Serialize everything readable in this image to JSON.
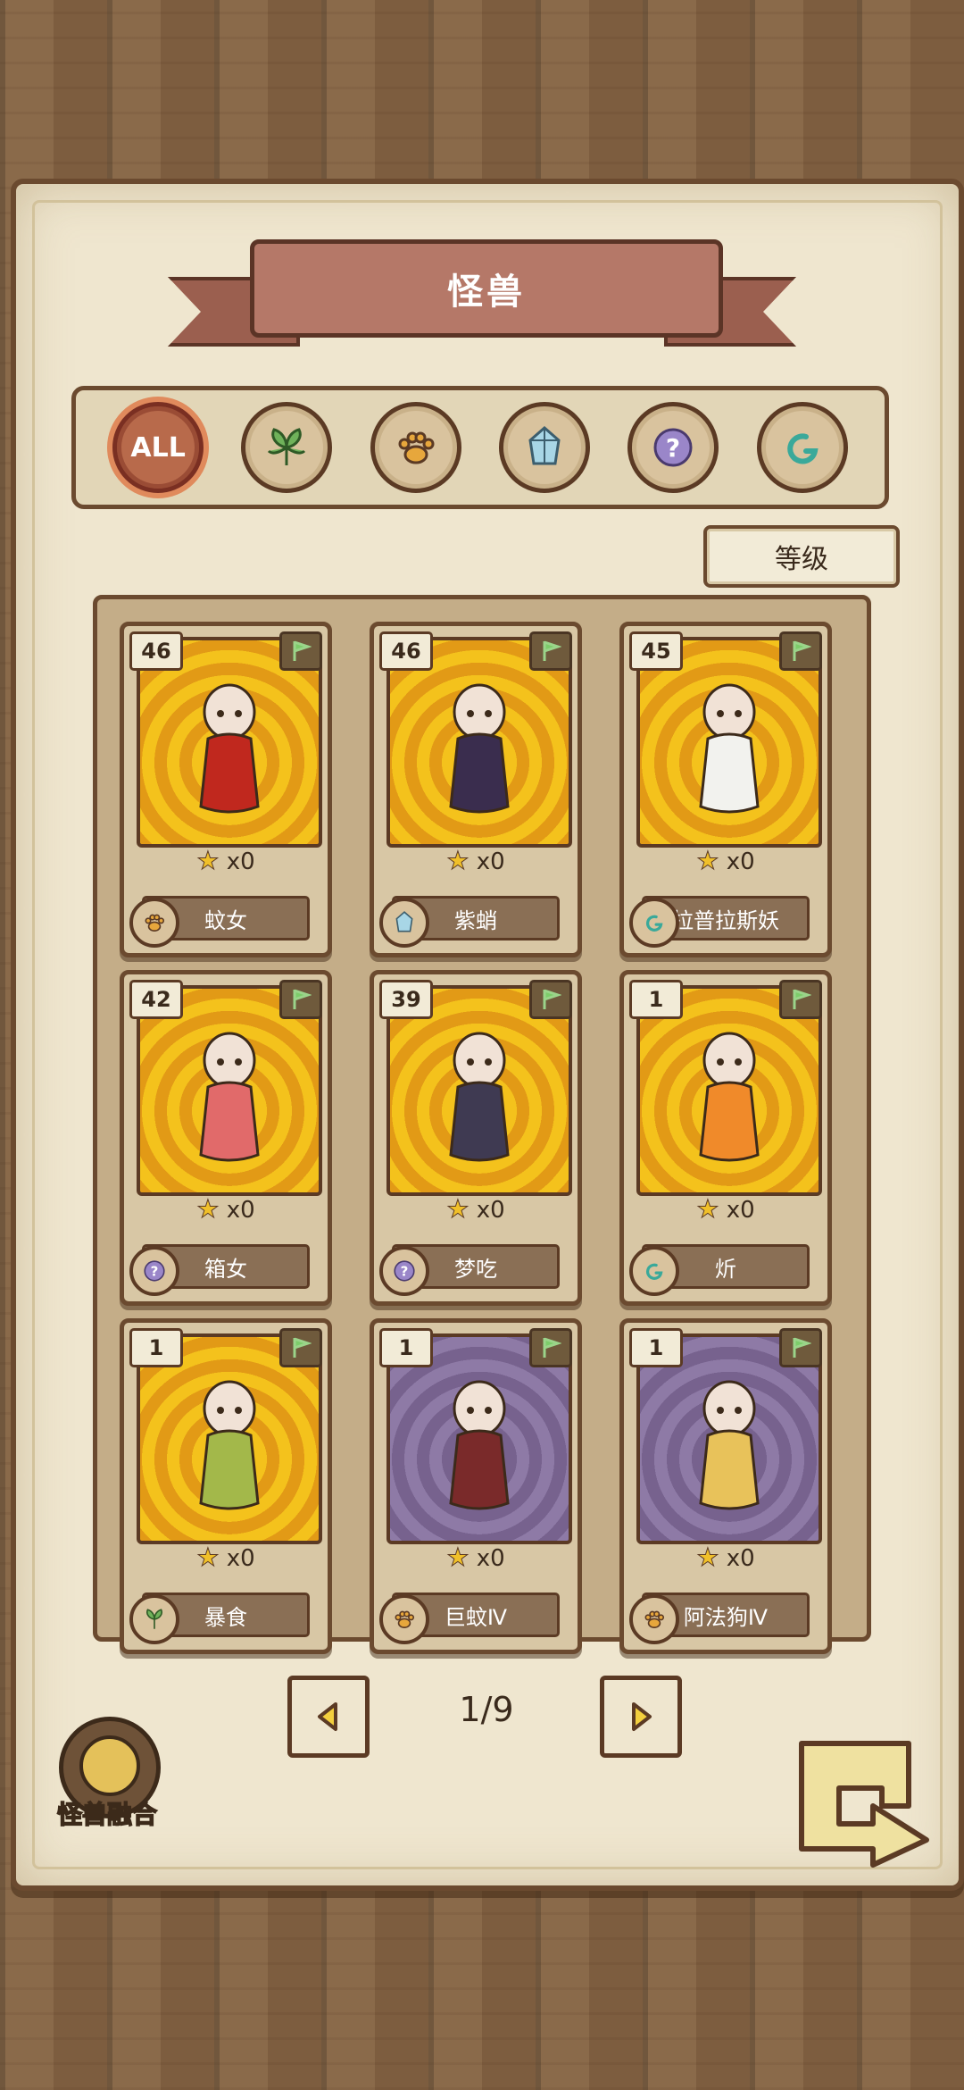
{
  "header": {
    "title": "怪兽"
  },
  "filters": [
    {
      "label": "ALL",
      "icon": "all-icon",
      "active": true
    },
    {
      "label": "",
      "icon": "leaf-icon",
      "active": false
    },
    {
      "label": "",
      "icon": "paw-icon",
      "active": false
    },
    {
      "label": "",
      "icon": "crystal-icon",
      "active": false
    },
    {
      "label": "",
      "icon": "question-icon",
      "active": false
    },
    {
      "label": "",
      "icon": "swirl-icon",
      "active": false
    }
  ],
  "sort": {
    "label": "等级"
  },
  "cards": [
    {
      "level": "46",
      "name": "蚊女",
      "stars": "x0",
      "type_icon": "paw-icon",
      "art": "gold"
    },
    {
      "level": "46",
      "name": "紫蛸",
      "stars": "x0",
      "type_icon": "crystal-icon",
      "art": "gold"
    },
    {
      "level": "45",
      "name": "拉普拉斯妖",
      "stars": "x0",
      "type_icon": "swirl-icon",
      "art": "gold"
    },
    {
      "level": "42",
      "name": "箱女",
      "stars": "x0",
      "type_icon": "question-icon",
      "art": "gold"
    },
    {
      "level": "39",
      "name": "梦吃",
      "stars": "x0",
      "type_icon": "question-icon",
      "art": "gold"
    },
    {
      "level": "1",
      "name": "炘",
      "stars": "x0",
      "type_icon": "swirl-icon",
      "art": "gold"
    },
    {
      "level": "1",
      "name": "暴食",
      "stars": "x0",
      "type_icon": "leaf-icon",
      "art": "gold"
    },
    {
      "level": "1",
      "name": "巨蚊Ⅳ",
      "stars": "x0",
      "type_icon": "paw-icon",
      "art": "purple"
    },
    {
      "level": "1",
      "name": "阿法狗Ⅳ",
      "stars": "x0",
      "type_icon": "paw-icon",
      "art": "purple"
    }
  ],
  "pager": {
    "text": "1/9"
  },
  "fusion": {
    "label": "怪兽融合"
  },
  "colors": {
    "accent": "#b86a4b",
    "gold": "#f4c21c",
    "purple": "#77628e",
    "dark": "#5b3a24"
  }
}
